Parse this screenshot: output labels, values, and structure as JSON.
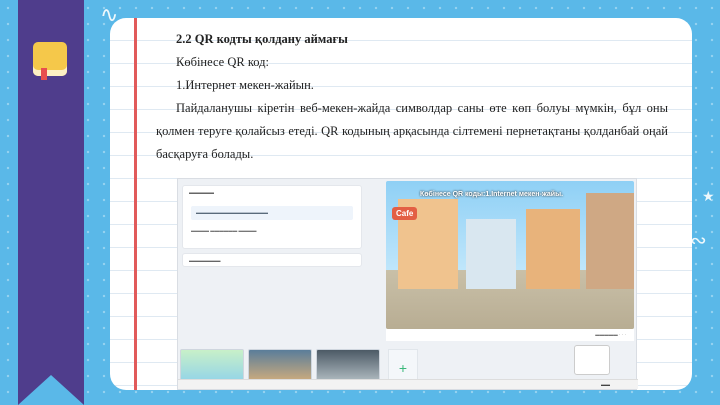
{
  "document": {
    "heading": "2.2 QR кодты қолдану аймағы",
    "line1": "Көбінесе QR код:",
    "line2": "1.Интернет мекен-жайын.",
    "paragraph": "Пайдаланушы кіретін веб-мекен-жайда символдар саны өте көп болуы мүмкін, бұл оны қолмен теруге қолайсыз етеді. QR кодының арқасында сілтемені пернетақтаны қолданбай оңай басқаруға болады."
  },
  "embedded_screenshot": {
    "video_caption": "Көбінесе QR коды:1.Internet мекен-жайы.",
    "cafe_sign": "Cafe",
    "plus_label": "+"
  },
  "colors": {
    "background": "#5ab8e8",
    "ribbon": "#4f3d8c",
    "margin_line": "#e15a5a",
    "book": "#f5c84a"
  }
}
